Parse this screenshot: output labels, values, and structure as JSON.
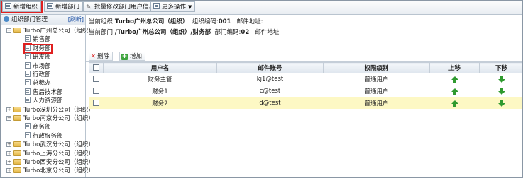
{
  "toolbar": {
    "new_org": "新增组织",
    "new_dept": "新增部门",
    "batch_edit": "批量修改部门用户信息",
    "more": "更多操作"
  },
  "left": {
    "title": "组织部门管理",
    "refresh": "[刷新]",
    "tree": [
      {
        "label": "Turbo广州总公司（组织）",
        "type": "org",
        "expanded": true
      },
      {
        "label": "销售部",
        "type": "dept"
      },
      {
        "label": "财务部",
        "type": "dept",
        "selected": true
      },
      {
        "label": "研发部",
        "type": "dept"
      },
      {
        "label": "市场部",
        "type": "dept"
      },
      {
        "label": "行政部",
        "type": "dept"
      },
      {
        "label": "总裁办",
        "type": "dept"
      },
      {
        "label": "售后技术部",
        "type": "dept"
      },
      {
        "label": "人力资源部",
        "type": "dept"
      },
      {
        "label": "Turbo深圳分公司（组织）",
        "type": "org",
        "expanded": false
      },
      {
        "label": "Turbo南京分公司（组织）",
        "type": "org",
        "expanded": true
      },
      {
        "label": "商务部",
        "type": "dept"
      },
      {
        "label": "行政服务部",
        "type": "dept"
      },
      {
        "label": "Turbo武汉分公司（组织）",
        "type": "org",
        "expanded": false
      },
      {
        "label": "Turbo上海分公司（组织）",
        "type": "org",
        "expanded": false
      },
      {
        "label": "Turbo西安分公司（组织）",
        "type": "org",
        "expanded": false
      },
      {
        "label": "Turbo北京分公司（组织）",
        "type": "org",
        "expanded": false
      }
    ]
  },
  "info1": {
    "org_prefix": "当前组织:",
    "org_name": "Turbo广州总公司（组织）",
    "code_prefix": "组织编码:",
    "code": "001",
    "mail_label": "邮件地址:"
  },
  "info2": {
    "dept_prefix": "当前部门:",
    "dept_path": "/Turbo广州总公司（组织）/财务部",
    "code_prefix": "部门编码:",
    "code": "02",
    "mail_label": "邮件地址"
  },
  "actions": {
    "delete": "删除",
    "add": "增加"
  },
  "table": {
    "headers": [
      "用户名",
      "邮件账号",
      "权限级别",
      "上移",
      "下移"
    ],
    "rows": [
      {
        "name": "财务主管",
        "email": "kj1@test",
        "level": "普通用户"
      },
      {
        "name": "财务1",
        "email": "c@test",
        "level": "普通用户"
      },
      {
        "name": "财务2",
        "email": "d@test",
        "level": "普通用户",
        "highlight": true
      }
    ]
  }
}
